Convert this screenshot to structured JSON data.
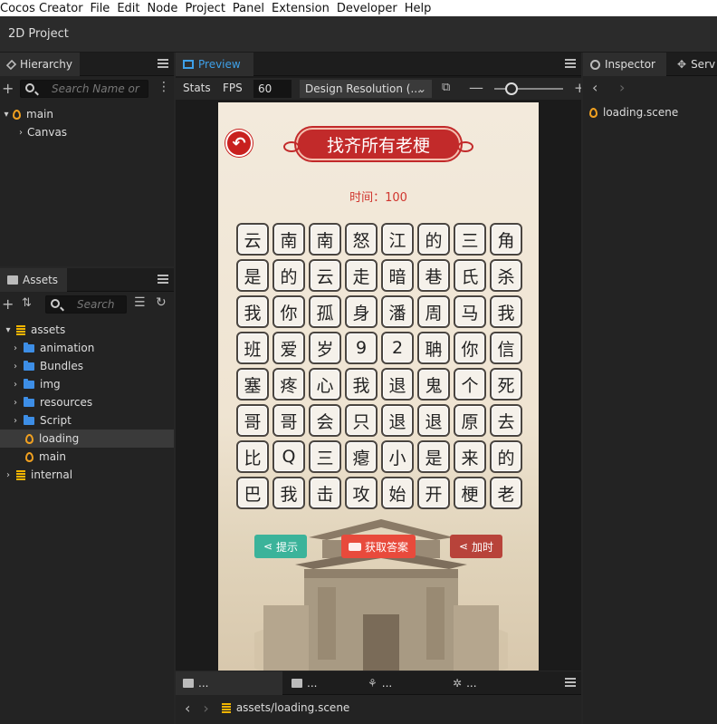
{
  "menubar": [
    "Cocos Creator",
    "File",
    "Edit",
    "Node",
    "Project",
    "Panel",
    "Extension",
    "Developer",
    "Help"
  ],
  "project_title": "2D Project",
  "hierarchy": {
    "tab": "Hierarchy",
    "search_placeholder": "Search Name or",
    "nodes": [
      "main",
      "Canvas"
    ]
  },
  "assets": {
    "tab": "Assets",
    "search_placeholder": "Search",
    "items": [
      "assets",
      "animation",
      "Bundles",
      "img",
      "resources",
      "Script",
      "loading",
      "main",
      "internal"
    ]
  },
  "preview": {
    "tab": "Preview",
    "stats_label": "Stats",
    "fps_label": "FPS",
    "fps_value": "60",
    "design_resolution": "Design Resolution (..."
  },
  "inspector": {
    "tab": "Inspector",
    "tab2": "Serv",
    "file": "loading.scene"
  },
  "game": {
    "title": "找齐所有老梗",
    "timer": "时间：100",
    "grid": [
      [
        "云",
        "南",
        "南",
        "怒",
        "江",
        "的",
        "三",
        "角"
      ],
      [
        "是",
        "的",
        "云",
        "走",
        "暗",
        "巷",
        "氏",
        "杀"
      ],
      [
        "我",
        "你",
        "孤",
        "身",
        "潘",
        "周",
        "马",
        "我"
      ],
      [
        "班",
        "爱",
        "岁",
        "9",
        "2",
        "聃",
        "你",
        "信"
      ],
      [
        "塞",
        "疼",
        "心",
        "我",
        "退",
        "鬼",
        "个",
        "死"
      ],
      [
        "哥",
        "哥",
        "会",
        "只",
        "退",
        "退",
        "原",
        "去"
      ],
      [
        "比",
        "Q",
        "三",
        "瘪",
        "小",
        "是",
        "来",
        "的"
      ],
      [
        "巴",
        "我",
        "击",
        "攻",
        "始",
        "开",
        "梗",
        "老"
      ]
    ],
    "btn_hint": "提示",
    "btn_answer": "获取答案",
    "btn_time": "加时",
    "colors": {
      "hint": "#3bb39a",
      "answer": "#e84a3c",
      "time": "#b8433a",
      "banner": "#c22a2a"
    }
  },
  "console": {
    "tabs": [
      "...",
      "...",
      "...",
      "..."
    ],
    "path_prefix": "assets",
    "path_file": "loading.scene"
  }
}
